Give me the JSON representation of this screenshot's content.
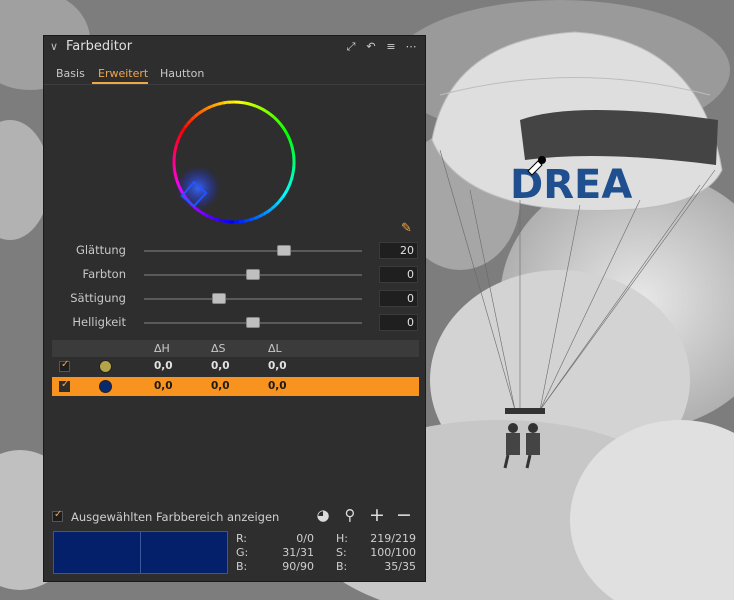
{
  "panel": {
    "title": "Farbeditor",
    "collapse_icon": "chevron-down-icon",
    "header_icons": [
      "expand-icon",
      "reset-icon",
      "list-menu-icon",
      "more-options-icon"
    ]
  },
  "tabs": [
    {
      "label": "Basis",
      "active": false
    },
    {
      "label": "Erweitert",
      "active": true
    },
    {
      "label": "Hautton",
      "active": false
    }
  ],
  "sliders": [
    {
      "label": "Glättung",
      "value": "20",
      "level": 0.64
    },
    {
      "label": "Farbton",
      "value": "0",
      "level": 0.5
    },
    {
      "label": "Sättigung",
      "value": "0",
      "level": 0.34
    },
    {
      "label": "Helligkeit",
      "value": "0",
      "level": 0.5
    }
  ],
  "table": {
    "headers": [
      "ΔH",
      "ΔS",
      "ΔL"
    ],
    "rows": [
      {
        "checked": true,
        "swatch": "#b3a44a",
        "dh": "0,0",
        "ds": "0,0",
        "dl": "0,0",
        "selected": false
      },
      {
        "checked": true,
        "swatch": "#0a2a6e",
        "dh": "0,0",
        "ds": "0,0",
        "dl": "0,0",
        "selected": true
      }
    ]
  },
  "show_range": {
    "label": "Ausgewählten Farbbereich anzeigen",
    "checked": true
  },
  "bottom_icons": [
    "pie-chart-icon",
    "color-picker-icon",
    "add-icon",
    "remove-icon"
  ],
  "readout": {
    "R": "0/0",
    "G": "31/31",
    "B": "90/90",
    "H": "219/219",
    "S": "100/100",
    "Bv": "35/35"
  },
  "swatch_color": "#05206a",
  "accent_color": "#f7931e",
  "background_text": "DREA"
}
